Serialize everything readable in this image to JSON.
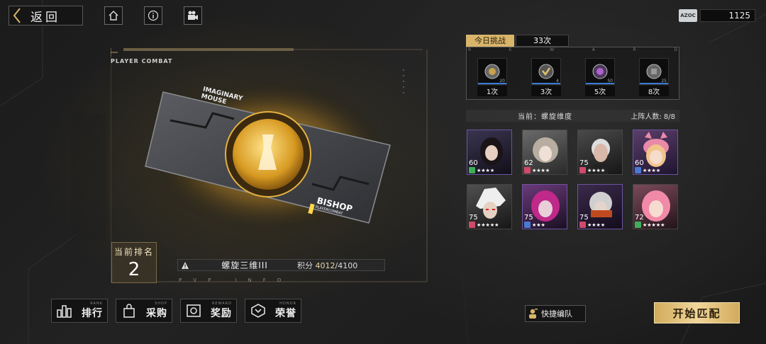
{
  "topbar": {
    "back_label": "返回",
    "currency": {
      "icon_text": "AZOC",
      "value": "1125"
    }
  },
  "card_panel": {
    "player_combat_label": "PLAYER COMBAT",
    "card_title_line1": "IMAGINARY",
    "card_title_line2": "MOUSE",
    "card_rank_name": "BISHOP",
    "card_rank_sub": "PLAYERCOMBAT",
    "rank_label": "当前排名",
    "rank_value": "2",
    "season_name": "螺旋三维III",
    "score_label": "积分",
    "score_current": "4012",
    "score_sep": "/",
    "score_target": "4100",
    "pvp_info": "PVP INFO"
  },
  "nav": [
    {
      "en": "RANK",
      "cn": "排行",
      "icon": "bar-chart-icon"
    },
    {
      "en": "SHOP",
      "cn": "采购",
      "icon": "shopping-bag-icon"
    },
    {
      "en": "REWARD",
      "cn": "奖励",
      "icon": "reward-box-icon"
    },
    {
      "en": "HONOR",
      "cn": "荣誉",
      "icon": "honor-badge-icon"
    }
  ],
  "challenge": {
    "label": "今日挑战",
    "count": "33次",
    "reward_letters": [
      "R",
      "E",
      "W",
      "A",
      "R",
      "D"
    ],
    "rewards": [
      {
        "threshold": "20",
        "label": "1次",
        "progress": 1.0
      },
      {
        "threshold": "4",
        "label": "3次",
        "progress": 1.0
      },
      {
        "threshold": "50",
        "label": "5次",
        "progress": 1.0
      },
      {
        "threshold": "25",
        "label": "8次",
        "progress": 1.0
      }
    ]
  },
  "team": {
    "current_label": "当前：",
    "current_name": "螺旋维度",
    "count_label": "上阵人数:",
    "count_value": "8/8",
    "heroes": [
      {
        "level": "60",
        "stars": "★★★★",
        "class_color": "#3fae5a",
        "palette": "dark-hair"
      },
      {
        "level": "62",
        "stars": "★★★★",
        "class_color": "#d04a6a",
        "palette": "grey-hair"
      },
      {
        "level": "75",
        "stars": "★★★★",
        "class_color": "#d04a6a",
        "palette": "white-beard"
      },
      {
        "level": "60",
        "stars": "★★★★",
        "class_color": "#4a7ad0",
        "palette": "pink-cat"
      },
      {
        "level": "75",
        "stars": "★★★★★",
        "class_color": "#d04a6a",
        "palette": "white-hair-red-eyes"
      },
      {
        "level": "75",
        "stars": "★★★",
        "class_color": "#4a7ad0",
        "palette": "magenta-hair"
      },
      {
        "level": "75",
        "stars": "★★★★",
        "class_color": "#d04a6a",
        "palette": "silver-masked"
      },
      {
        "level": "72",
        "stars": "★★★★★",
        "class_color": "#3fae5a",
        "palette": "pink-hair"
      }
    ]
  },
  "actions": {
    "quick_team_label": "快捷编队",
    "start_match_label": "开始匹配"
  },
  "colors": {
    "gold": "#d9b56a",
    "accent_frame": "#b29a66"
  }
}
